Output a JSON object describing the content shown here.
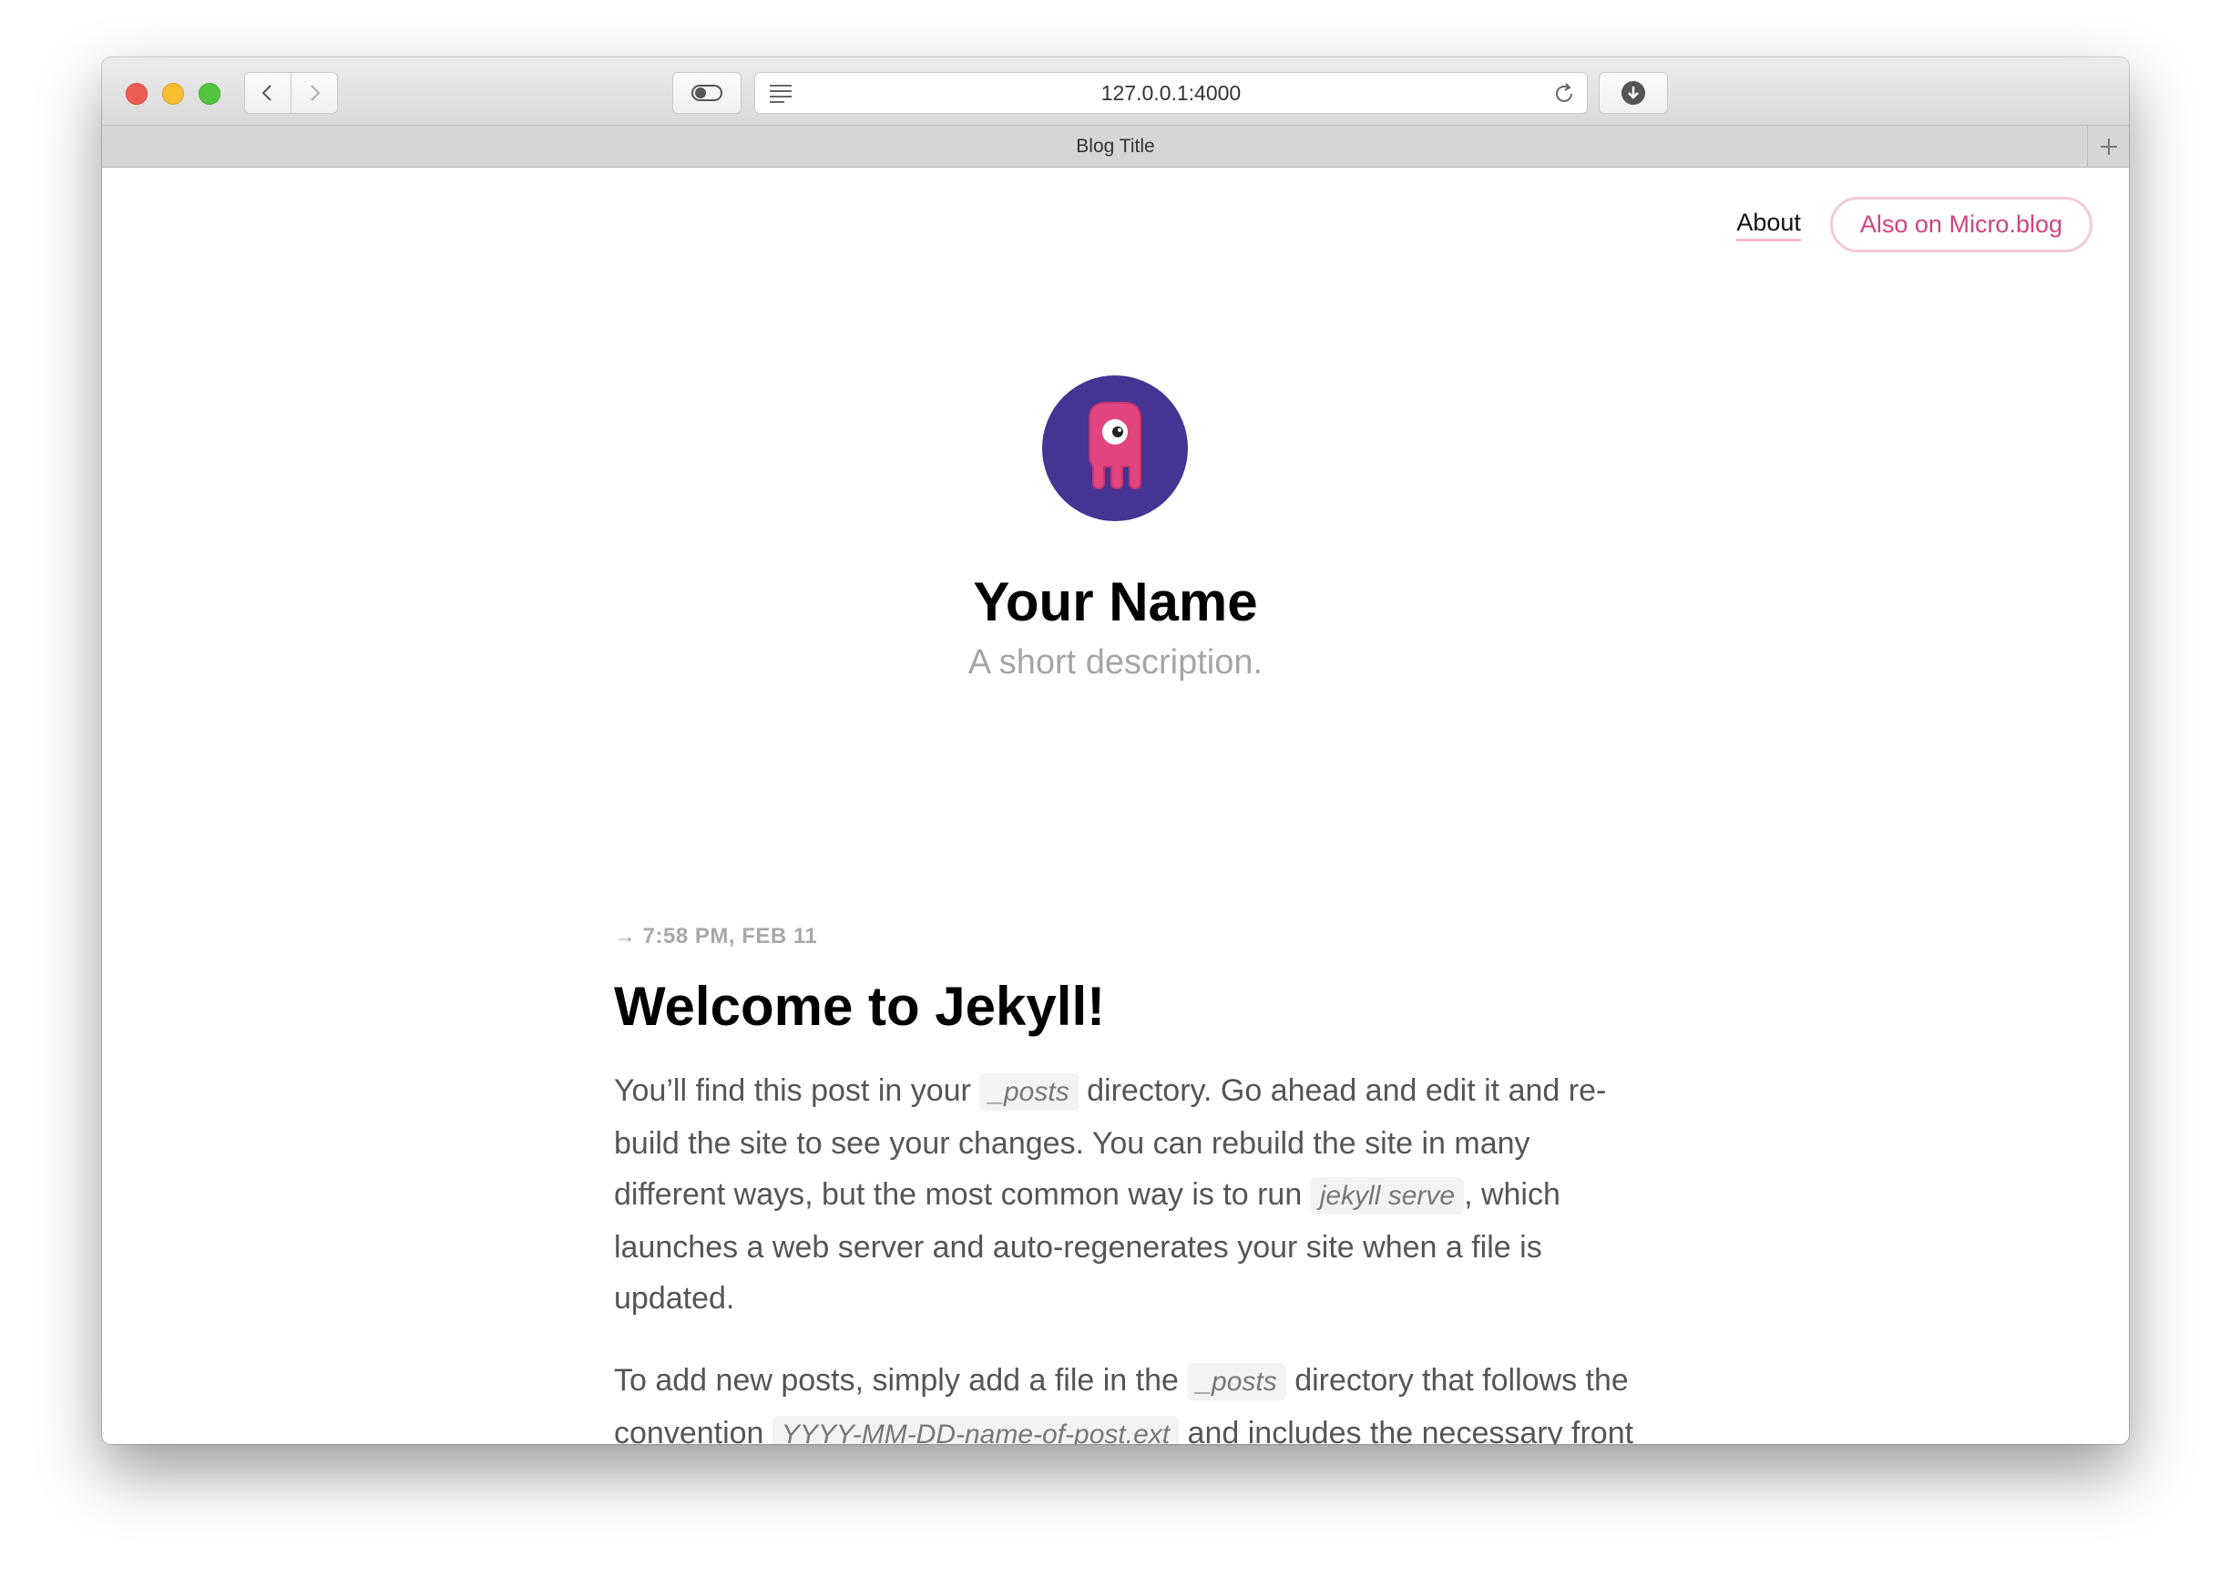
{
  "browser": {
    "url": "127.0.0.1:4000",
    "tab_title": "Blog Title"
  },
  "nav": {
    "about": "About",
    "microblog": "Also on Micro.blog"
  },
  "profile": {
    "name": "Your Name",
    "description": "A short description."
  },
  "post": {
    "date": "→ 7:58 PM, FEB 11",
    "title": "Welcome to Jekyll!",
    "p1": {
      "t1": "You’ll find this post in your ",
      "c1": "_posts",
      "t2": " directory. Go ahead and edit it and re-build the site to see your changes. You can rebuild the site in many different ways, but the most common way is to run ",
      "c2": "jekyll serve",
      "t3": ", which launches a web server and auto-regenerates your site when a file is updated."
    },
    "p2": {
      "t1": "To add new posts, simply add a file in the ",
      "c1": "_posts",
      "t2": " directory that follows the convention ",
      "c2": "YYYY-MM-DD-name-of-post.ext",
      "t3": " and includes the necessary front matter. Take a look at the source for this post to get an"
    }
  },
  "colors": {
    "accent": "#d1447f",
    "avatar_bg": "#453494",
    "avatar_figure": "#e2457f"
  }
}
